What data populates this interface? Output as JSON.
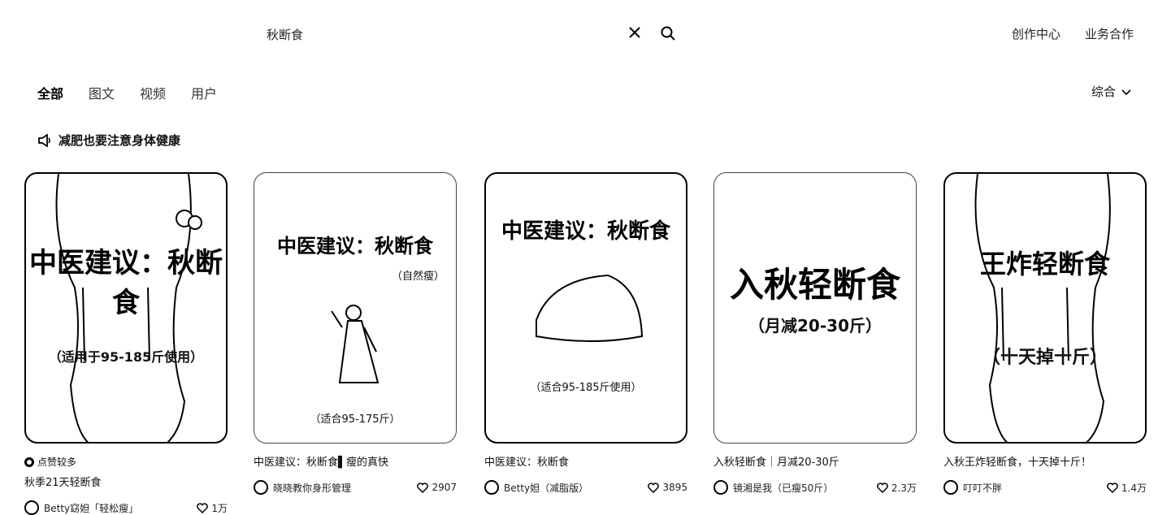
{
  "search": {
    "query": "秋断食"
  },
  "header": {
    "links": [
      "创作中心",
      "业务合作"
    ]
  },
  "tabs": [
    "全部",
    "图文",
    "视频",
    "用户"
  ],
  "sort": {
    "label": "综合"
  },
  "notice": {
    "text": "减肥也要注意身体健康"
  },
  "cards": [
    {
      "cover_main": "中医建议：秋断食",
      "cover_sub": "（适用于95-185斤使用）",
      "badge": "点赞较多",
      "title": "秋季21天轻断食",
      "author": "Betty窈妲「轻松瘦」",
      "likes": "1万"
    },
    {
      "cover_main": "中医建议：秋断食",
      "cover_tag": "（自然瘦）",
      "cover_sub": "（适合95-175斤）",
      "title": "中医建议：秋断食▌瘦的真快",
      "author": "晓晓教你身形管理",
      "likes": "2907"
    },
    {
      "cover_main": "中医建议：秋断食",
      "cover_sub": "（适合95-185斤使用）",
      "title": "中医建议：秋断食",
      "author": "Betty妲（减脂版）",
      "likes": "3895"
    },
    {
      "cover_main": "入秋轻断食",
      "cover_sub": "（月减20-30斤）",
      "title": "入秋轻断食｜月减20-30斤",
      "author": "镜湘是我（已瘦50斤）",
      "likes": "2.3万"
    },
    {
      "cover_main": "王炸轻断食",
      "cover_sub": "（十天掉十斤）",
      "title": "入秋王炸轻断食，十天掉十斤！",
      "author": "叮叮不胖",
      "likes": "1.4万"
    }
  ]
}
